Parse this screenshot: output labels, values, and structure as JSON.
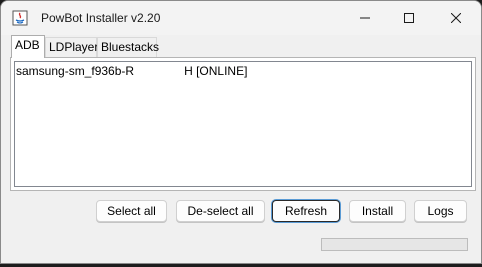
{
  "window": {
    "title": "PowBot Installer v2.20",
    "controls": {
      "minimize": "—",
      "maximize": "☐",
      "close": "✕"
    }
  },
  "tabs": [
    {
      "label": "ADB",
      "active": true
    },
    {
      "label": "LDPlayer",
      "active": false
    },
    {
      "label": "Bluestacks",
      "active": false
    }
  ],
  "devices": [
    {
      "name_start": "samsung-sm_f936b-R",
      "name_end": "H [ONLINE]"
    }
  ],
  "buttons": {
    "select_all": "Select all",
    "deselect_all": "De-select all",
    "refresh": "Refresh",
    "install": "Install",
    "logs": "Logs"
  },
  "progress": {
    "value": 0
  },
  "colors": {
    "progress_fill": "#06b025",
    "focus_ring": "#5a9bd5"
  }
}
